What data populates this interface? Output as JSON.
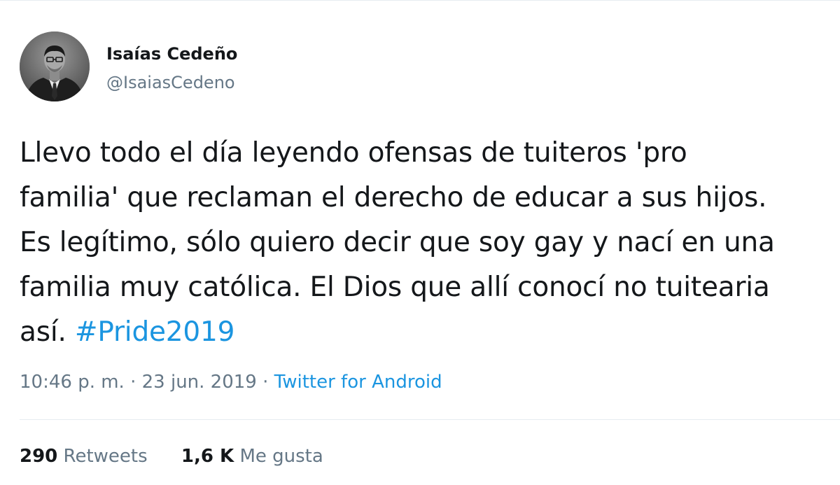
{
  "user": {
    "display_name": "Isaías Cedeño",
    "handle": "@IsaiasCedeno"
  },
  "tweet": {
    "lines": [
      "Llevo todo el día leyendo ofensas de tuiteros 'pro",
      "familia' que reclaman el derecho de educar a sus hijos.",
      "Es legítimo, sólo quiero decir que soy gay y nací en una",
      "familia muy católica. El Dios que allí conocí no tuitearia"
    ],
    "last_line_prefix": "así. ",
    "hashtag": "#Pride2019"
  },
  "meta": {
    "time": "10:46 p. m.",
    "separator1": " · ",
    "date": "23 jun. 2019",
    "separator2": " · ",
    "source": "Twitter for Android"
  },
  "stats": {
    "retweets_count": "290",
    "retweets_label": "Retweets",
    "likes_count": "1,6 K",
    "likes_label": "Me gusta"
  },
  "colors": {
    "link": "#1b95e0",
    "secondary_text": "#657786",
    "primary_text": "#14171a"
  },
  "icons": {
    "avatar": "profile-photo"
  }
}
